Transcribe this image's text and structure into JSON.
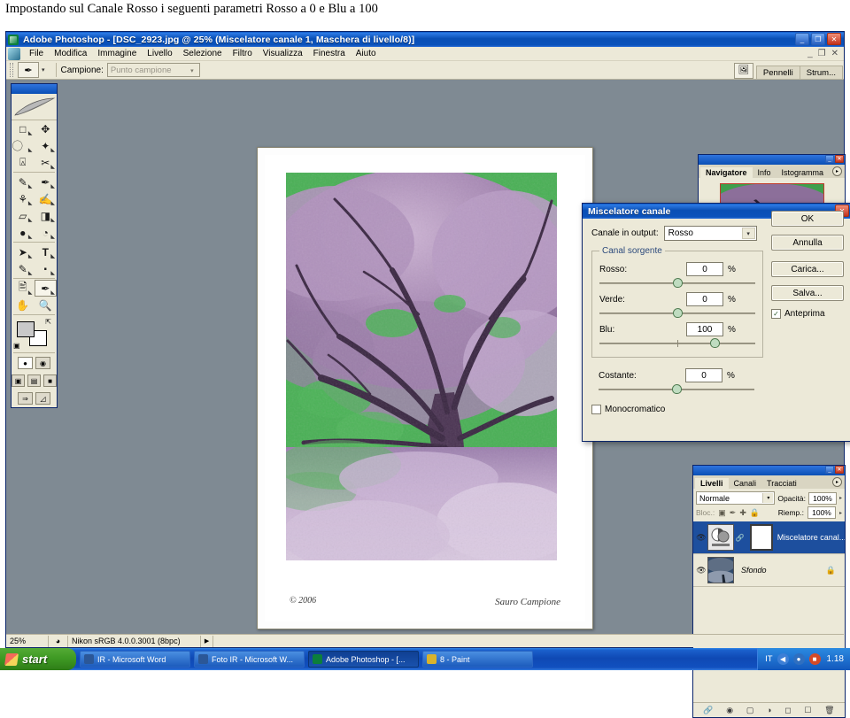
{
  "caption": "Impostando sul Canale Rosso i seguenti parametri Rosso a 0 e Blu a 100",
  "window": {
    "title": "Adobe Photoshop - [DSC_2923.jpg @ 25% (Miscelatore canale 1, Maschera di livello/8)]",
    "app_icon": "photoshop-icon",
    "buttons": {
      "minimize": "_",
      "restore": "❐",
      "close": "✕"
    },
    "doc_buttons": {
      "minimize": "_",
      "restore": "❐",
      "close": "✕"
    }
  },
  "menubar": {
    "items": [
      "File",
      "Modifica",
      "Immagine",
      "Livello",
      "Selezione",
      "Filtro",
      "Visualizza",
      "Finestra",
      "Aiuto"
    ]
  },
  "optionsbar": {
    "tool_icon": "eyedropper-icon",
    "caret": "▾",
    "label": "Campione:",
    "select_value": "Punto campione",
    "select_arrow": "▾",
    "right_icon": "go-to-bridge-icon",
    "palette_well": [
      "Pennelli",
      "Strum..."
    ]
  },
  "toolbox": {
    "tools": [
      {
        "name": "marquee-tool",
        "glyph": "▭"
      },
      {
        "name": "move-tool",
        "glyph": "✥"
      },
      {
        "name": "lasso-tool",
        "glyph": "◠"
      },
      {
        "name": "magic-wand-tool",
        "glyph": "✦"
      },
      {
        "name": "crop-tool",
        "glyph": "⌗"
      },
      {
        "name": "slice-tool",
        "glyph": "✎"
      },
      {
        "name": "healing-brush-tool",
        "glyph": "✒"
      },
      {
        "name": "brush-tool",
        "glyph": "🖌"
      },
      {
        "name": "clone-stamp-tool",
        "glyph": "⚘"
      },
      {
        "name": "history-brush-tool",
        "glyph": "✑"
      },
      {
        "name": "eraser-tool",
        "glyph": "▱"
      },
      {
        "name": "gradient-tool",
        "glyph": "◨"
      },
      {
        "name": "blur-tool",
        "glyph": "◍"
      },
      {
        "name": "dodge-tool",
        "glyph": "◔"
      },
      {
        "name": "path-selection-tool",
        "glyph": "➤"
      },
      {
        "name": "type-tool",
        "glyph": "T"
      },
      {
        "name": "pen-tool",
        "glyph": "✐"
      },
      {
        "name": "shape-tool",
        "glyph": "⬭"
      },
      {
        "name": "notes-tool",
        "glyph": "🗒"
      },
      {
        "name": "eyedropper-tool",
        "glyph": "✎"
      },
      {
        "name": "hand-tool",
        "glyph": "✋"
      },
      {
        "name": "zoom-tool",
        "glyph": "🔍"
      }
    ],
    "selected_tool": "eyedropper-tool",
    "swatches": {
      "foreground": "#c9c9c9",
      "background": "#ffffff"
    },
    "screen_modes": [
      "standard-screen-mode",
      "full-screen-with-menubar",
      "full-screen-mode"
    ],
    "quickmask": [
      "edit-in-standard-mode",
      "edit-in-quick-mask-mode"
    ],
    "jump_to": [
      "jump-to-imageready-icon",
      "jump-icon"
    ]
  },
  "document": {
    "signature_left": "© 2006",
    "signature_right": "Sauro Campione"
  },
  "navigator_palette": {
    "tabs": [
      "Navigatore",
      "Info",
      "Istogramma"
    ],
    "active_tab": "Navigatore",
    "menu_glyph": "▸"
  },
  "layers_palette": {
    "tabs": [
      "Livelli",
      "Canali",
      "Tracciati"
    ],
    "active_tab": "Livelli",
    "menu_glyph": "▸",
    "blend_mode": "Normale",
    "blend_arrow": "▾",
    "opacity_label": "Opacità:",
    "opacity_value": "100%",
    "lock_label": "Bloc.:",
    "fill_label": "Riemp.:",
    "fill_value": "100%",
    "stepper_glyph": "▸",
    "lock_icons": [
      "lock-transparent-pixels-icon",
      "lock-image-pixels-icon",
      "lock-position-icon",
      "lock-all-icon"
    ],
    "layers": [
      {
        "name": "Miscelatore canal...",
        "selected": true,
        "visible": true,
        "italic": false,
        "has_mask": true,
        "locked": false
      },
      {
        "name": "Sfondo",
        "selected": false,
        "visible": true,
        "italic": true,
        "has_mask": false,
        "locked": true
      }
    ],
    "bottom_icons": [
      "link-layers-icon",
      "layer-style-icon",
      "layer-mask-icon",
      "adjustment-layer-icon",
      "new-group-icon",
      "new-layer-icon",
      "delete-layer-icon"
    ]
  },
  "dialog": {
    "title": "Miscelatore canale",
    "close_glyph": "✕",
    "output_label": "Canale in output:",
    "output_value": "Rosso",
    "output_arrow": "▾",
    "group_label": "Canal sorgente",
    "sliders": [
      {
        "name": "Rosso:",
        "value": "0",
        "unit": "%",
        "pos": 50
      },
      {
        "name": "Verde:",
        "value": "0",
        "unit": "%",
        "pos": 50
      },
      {
        "name": "Blu:",
        "value": "100",
        "unit": "%",
        "pos": 75
      }
    ],
    "constant": {
      "name": "Costante:",
      "value": "0",
      "unit": "%",
      "pos": 50
    },
    "monochrome_label": "Monocromatico",
    "monochrome_checked": false,
    "buttons": [
      "OK",
      "Annulla",
      "Carica...",
      "Salva..."
    ],
    "preview_label": "Anteprima",
    "preview_checked": true,
    "check_glyph": "✓"
  },
  "statusbar": {
    "zoom": "25%",
    "icon": "doc-sizes-icon",
    "info": "Nikon sRGB 4.0.0.3001 (8bpc)",
    "arrow": "▶"
  },
  "taskbar": {
    "start_label": "start",
    "items": [
      {
        "label": "IR - Microsoft Word",
        "icon": "word-icon",
        "color": "#2b5797",
        "active": false
      },
      {
        "label": "Foto IR - Microsoft W...",
        "icon": "word-icon",
        "color": "#2b5797",
        "active": false
      },
      {
        "label": "Adobe Photoshop - [...",
        "icon": "photoshop-icon",
        "color": "#0c7f3c",
        "active": true
      },
      {
        "label": "8 - Paint",
        "icon": "paint-icon",
        "color": "#d9b32c",
        "active": false
      }
    ],
    "tray": {
      "language": "IT",
      "icons": [
        "back-arrow-icon",
        "antivirus-icon",
        "network-icon"
      ],
      "clock": "1.18"
    }
  },
  "colors": {
    "titlebar_blue": "#0a4fb5",
    "dialog_face": "#ece9d8",
    "workspace_gray": "#7f8a93",
    "layer_selected": "#1d4f9e",
    "slider_thumb": "#bfdcc0"
  }
}
